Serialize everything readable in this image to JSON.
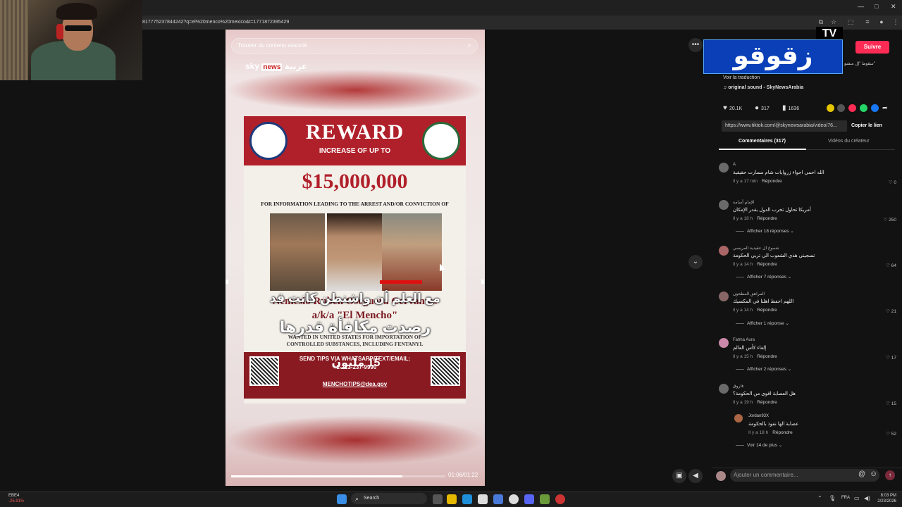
{
  "browser": {
    "url": "817775237844242?q=el%20menco%20mexico&t=1771872395429",
    "window_controls": [
      "—",
      "□",
      "✕"
    ]
  },
  "video": {
    "search_placeholder": "Trouver du contenu associé",
    "logo_sky": "sky",
    "logo_news": "news",
    "logo_arabic": "عربية",
    "poster": {
      "reward": "REWARD",
      "increase": "INCREASE OF UP TO",
      "amount": "$15,000,000",
      "info": "FOR INFORMATION LEADING TO THE ARREST AND/OR CONVICTION OF",
      "name": "Nemesio Rubén Oseguera Cervantes",
      "aka": "a/k/a \"El Mencho\"",
      "wanted_line1": "WANTED IN UNITED STATES FOR IMPORTATION OF",
      "wanted_line2": "CONTROLLED SUBSTANCES, INCLUDING FENTANYL",
      "tips_line1": "SEND TIPS VIA WHATSAPP/TEXT/EMAIL:",
      "tips_phone": "+1-213-237-9990",
      "tips_email": "MENCHOTIPS@dea.gov"
    },
    "caption_line1": "مع العلم أن واشنطن كانت قد",
    "caption_line2": "رصدت مكافأة قدرها",
    "caption_line3": "15 مليون",
    "progress_fraction": 0.8,
    "timecode": "01:06/01:22"
  },
  "overlay": {
    "chyron": "زقوقو",
    "tv": "TV"
  },
  "sidebar": {
    "follow": "Suivre",
    "snippet": "سقوط \"إل منشو\"",
    "translation": "Voir la traduction",
    "sound": "original sound - SkyNewsArabia",
    "stats": {
      "likes": "20.1K",
      "comments": "317",
      "saves": "1636"
    },
    "link": "https://www.tiktok.com/@skynewsarabia/video/76...",
    "copy_link": "Copier le lien",
    "tab_comments": "Commentaires (317)",
    "tab_creator": "Vidéos du créateur"
  },
  "comments": [
    {
      "user": "A",
      "text": "الله احمي اجواء زروايات شام مسارت حقيقية",
      "time": "Il y a 17 min",
      "reply": "Répondre",
      "likes": "0",
      "more": ""
    },
    {
      "user": "الإمام أسامة",
      "text": "أمريكا تحاول تخرب الدول بقدر الإمكان",
      "time": "Il y a 18 h",
      "reply": "Répondre",
      "likes": "250",
      "more": "Afficher 18 réponses"
    },
    {
      "user": "شموخ ال عقيدية المريسي",
      "text": "تسجيني هذي الشعوب الي تربي الحكومة",
      "time": "Il y a 14 h",
      "reply": "Répondre",
      "likes": "64",
      "more": "Afficher 7 réponses"
    },
    {
      "user": "المراهق المطحون",
      "text": "اللهم احفظ اهلنا في المكسيك",
      "time": "Il y a 14 h",
      "reply": "Répondre",
      "likes": "21",
      "more": "Afficher 1 réponse"
    },
    {
      "user": "Fatma Aura",
      "text": "إلغاء كأس العالم",
      "time": "Il y a 15 h",
      "reply": "Répondre",
      "likes": "17",
      "more": "Afficher 2 réponses"
    },
    {
      "user": "فاروق",
      "text": "هل العصابة اقوى من الحكومة؟",
      "time": "Il y a 19 h",
      "reply": "Répondre",
      "likes": "15",
      "more": ""
    }
  ],
  "reply": {
    "user": "Jordan93X",
    "text": "عصابة الها نفوذ بالحكومة",
    "time": "Il y a 18 h",
    "reply": "Répondre",
    "likes": "52"
  },
  "see_more": "Voir 14 de plus",
  "comment_placeholder": "Ajouter un commentaire...",
  "taskbar": {
    "stock_name": "EBE4",
    "stock_change": "-25.91%",
    "search": "Search",
    "lang": "FRA",
    "time": "8:03 PM",
    "date": "2/23/2026"
  },
  "colors": {
    "accent": "#fe2c55",
    "bg": "#121212",
    "reward_red": "#b0202a"
  }
}
